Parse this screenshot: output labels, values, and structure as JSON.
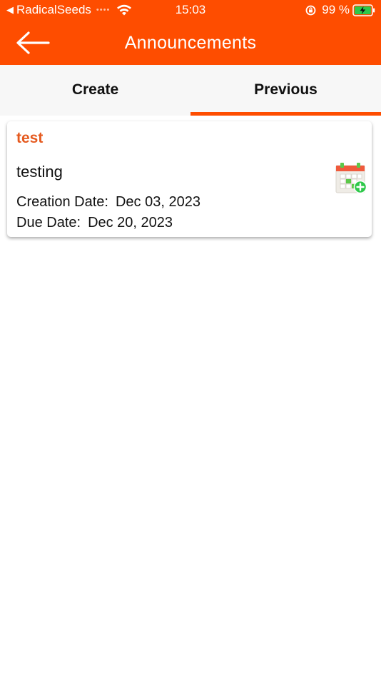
{
  "status_bar": {
    "back_indicator": "◀",
    "carrier": "RadicalSeeds",
    "signal_dots": "••••",
    "time": "15:03",
    "battery_percent": "99 %",
    "battery_level": 0.99,
    "battery_charging": true
  },
  "nav": {
    "title": "Announcements",
    "back_icon": "arrow-left-icon"
  },
  "tabs": [
    {
      "label": "Create",
      "active": false
    },
    {
      "label": "Previous",
      "active": true
    }
  ],
  "announcements": [
    {
      "title": "test",
      "body": "testing",
      "creation_label": "Creation Date:",
      "creation_date": "Dec 03, 2023",
      "due_label": "Due Date:",
      "due_date": "Dec 20, 2023",
      "action_icon": "add-to-calendar-icon"
    }
  ],
  "colors": {
    "accent": "#fe4d00",
    "title_text": "#e55a1f",
    "tab_background": "#f7f7f7",
    "calendar_plus": "#2ec84a",
    "calendar_top": "#f05a3c"
  }
}
